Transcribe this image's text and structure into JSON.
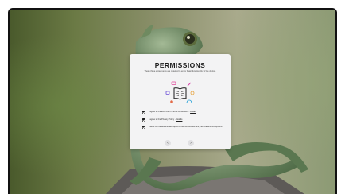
{
  "dialog": {
    "title": "PERMISSIONS",
    "subtitle": "These three agreements are required to enjoy basic functionality of the device.",
    "items": [
      {
        "text": "I agree to the End User License Agreement",
        "link": "Details",
        "checked": true
      },
      {
        "text": "I agree to the Privacy Policy",
        "link": "Details",
        "checked": true
      },
      {
        "text": "I allow the default installed apps to use location service, camera and microphone",
        "link": "",
        "checked": true
      }
    ],
    "nav": {
      "back_icon": "chevron-left-icon",
      "back_glyph": "‹",
      "next_icon": "chevron-right-icon",
      "next_glyph": "›"
    }
  },
  "illustration": {
    "main_icon": "open-book-icon",
    "accent_colors": [
      "#e0489a",
      "#6c4fd8",
      "#e6a23c",
      "#e36a47",
      "#2ea4d8"
    ]
  }
}
